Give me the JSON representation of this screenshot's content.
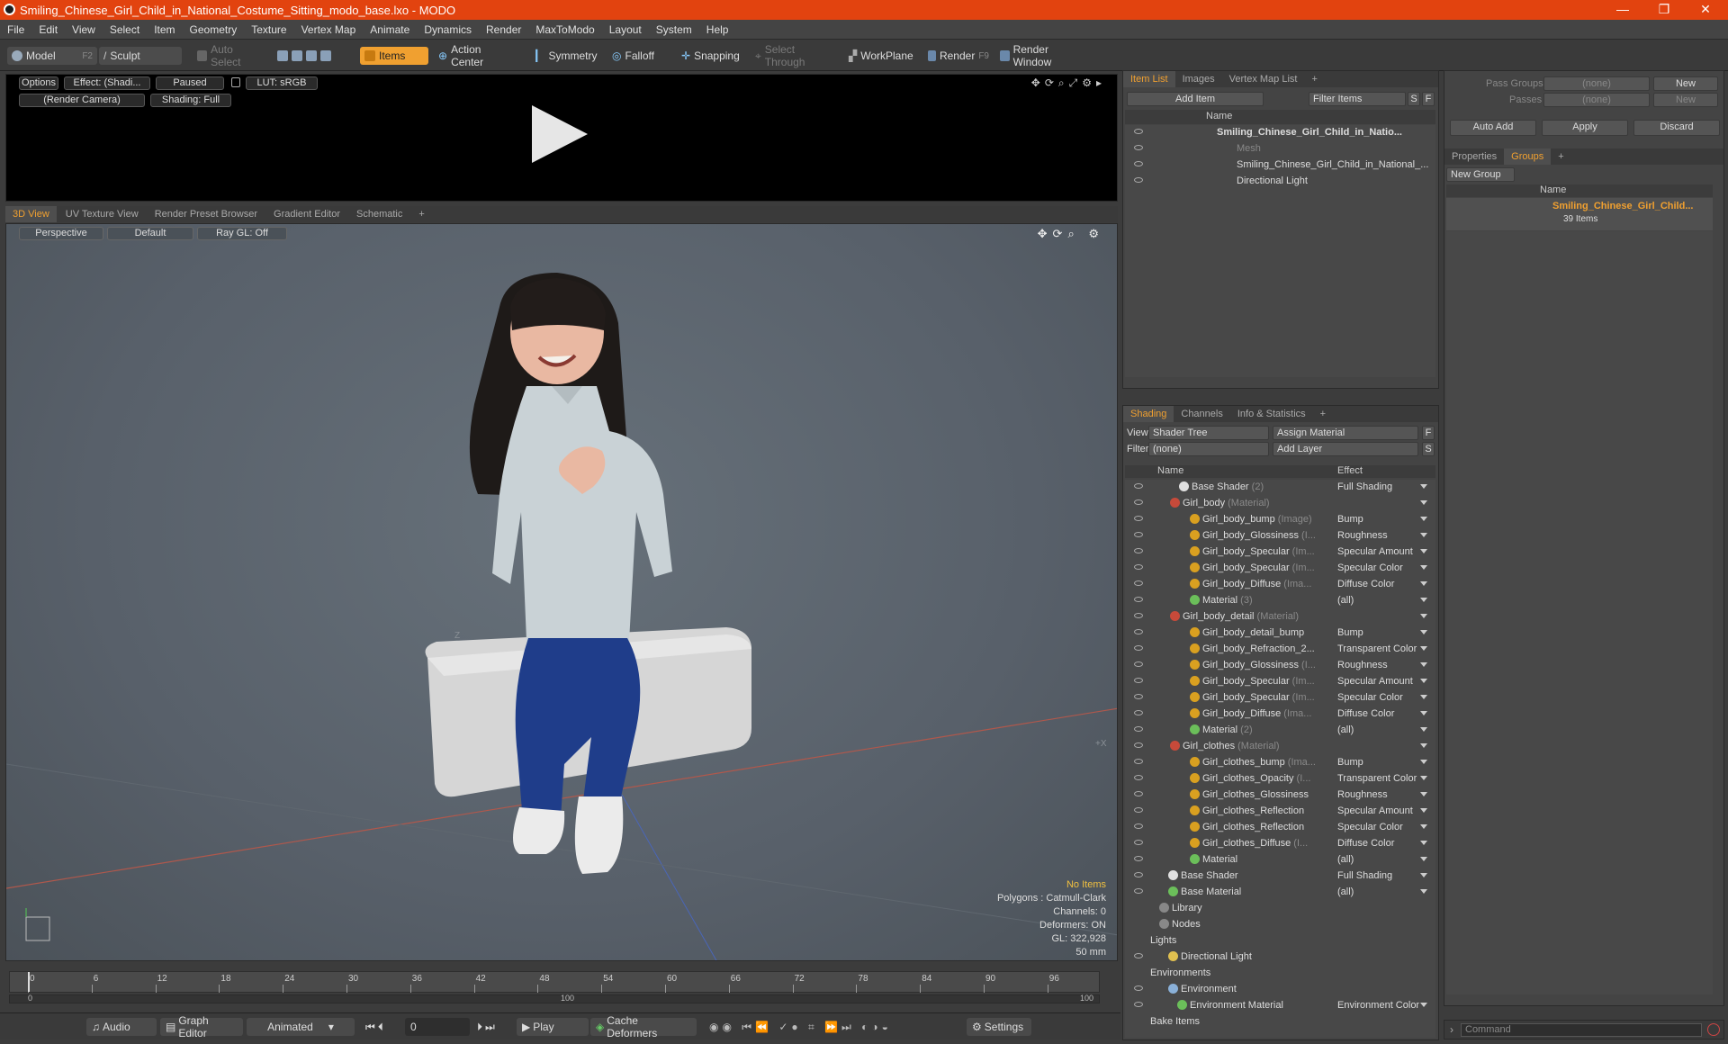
{
  "window": {
    "title": "Smiling_Chinese_Girl_Child_in_National_Costume_Sitting_modo_base.lxo - MODO",
    "min": "—",
    "max": "❐",
    "close": "✕"
  },
  "menu": [
    "File",
    "Edit",
    "View",
    "Select",
    "Item",
    "Geometry",
    "Texture",
    "Vertex Map",
    "Animate",
    "Dynamics",
    "Render",
    "MaxToModo",
    "Layout",
    "System",
    "Help"
  ],
  "toolbar": {
    "model": "Model",
    "model_key": "F2",
    "sculpt": "Sculpt",
    "auto_select": "Auto Select",
    "items": "Items",
    "action_center": "Action Center",
    "symmetry": "Symmetry",
    "falloff": "Falloff",
    "snapping": "Snapping",
    "select_through": "Select Through",
    "workplane": "WorkPlane",
    "render": "Render",
    "render_key": "F9",
    "render_window": "Render Window"
  },
  "preview": {
    "options": "Options",
    "effect": "Effect: (Shadi...",
    "paused": "Paused",
    "lut": "LUT: sRGB",
    "camera": "(Render Camera)",
    "shading": "Shading: Full"
  },
  "view_tabs": [
    "3D View",
    "UV Texture View",
    "Render Preset Browser",
    "Gradient Editor",
    "Schematic",
    "+"
  ],
  "viewport": {
    "perspective": "Perspective",
    "default": "Default",
    "raygl": "Ray GL: Off",
    "axis_z": "Z",
    "axis_x": "+X"
  },
  "stats": {
    "no_items": "No Items",
    "polygons": "Polygons : Catmull-Clark",
    "channels": "Channels: 0",
    "deformers": "Deformers: ON",
    "gl": "GL: 322,928",
    "focal": "50 mm"
  },
  "timeline": {
    "ticks": [
      "0",
      "6",
      "12",
      "18",
      "24",
      "30",
      "36",
      "42",
      "48",
      "54",
      "60",
      "66",
      "72",
      "78",
      "84",
      "90",
      "96"
    ],
    "start": "0",
    "mid": "100",
    "end": "100"
  },
  "bottom": {
    "audio": "Audio",
    "graph_editor": "Graph Editor",
    "animated": "Animated",
    "frame": "0",
    "play": "Play",
    "cache": "Cache Deformers",
    "settings": "Settings"
  },
  "itemlist": {
    "tabs": [
      "Item List",
      "Images",
      "Vertex Map List",
      "+"
    ],
    "add_item": "Add Item",
    "filter_items": "Filter Items",
    "s": "S",
    "f": "F",
    "col_name": "Name",
    "rows": [
      "Smiling_Chinese_Girl_Child_in_Natio...",
      "Mesh",
      "Smiling_Chinese_Girl_Child_in_National_...",
      "Directional Light"
    ]
  },
  "shading": {
    "tabs": [
      "Shading",
      "Channels",
      "Info & Statistics",
      "+"
    ],
    "view_label": "View",
    "view_value": "Shader Tree",
    "assign": "Assign Material",
    "filter_label": "Filter",
    "filter_value": "(none)",
    "add_layer": "Add Layer",
    "f": "F",
    "s": "S",
    "col_name": "Name",
    "col_effect": "Effect",
    "rows": [
      {
        "name": "Base Shader",
        "sub": "(2)",
        "effect": "Full Shading",
        "indent": 48,
        "kind": "shader"
      },
      {
        "name": "Girl_body",
        "sub": "(Material)",
        "effect": "",
        "indent": 38,
        "kind": "mat"
      },
      {
        "name": "Girl_body_bump",
        "sub": "(Image)",
        "effect": "Bump",
        "indent": 60,
        "kind": "img"
      },
      {
        "name": "Girl_body_Glossiness",
        "sub": "(I...",
        "effect": "Roughness",
        "indent": 60,
        "kind": "img"
      },
      {
        "name": "Girl_body_Specular",
        "sub": "(Im...",
        "effect": "Specular Amount",
        "indent": 60,
        "kind": "img"
      },
      {
        "name": "Girl_body_Specular",
        "sub": "(Im...",
        "effect": "Specular Color",
        "indent": 60,
        "kind": "img"
      },
      {
        "name": "Girl_body_Diffuse",
        "sub": "(Ima...",
        "effect": "Diffuse Color",
        "indent": 60,
        "kind": "img"
      },
      {
        "name": "Material",
        "sub": "(3)",
        "effect": "(all)",
        "indent": 60,
        "kind": "matg"
      },
      {
        "name": "Girl_body_detail",
        "sub": "(Material)",
        "effect": "",
        "indent": 38,
        "kind": "mat"
      },
      {
        "name": "Girl_body_detail_bump",
        "sub": "",
        "effect": "Bump",
        "indent": 60,
        "kind": "img"
      },
      {
        "name": "Girl_body_Refraction_2...",
        "sub": "",
        "effect": "Transparent Color",
        "indent": 60,
        "kind": "img"
      },
      {
        "name": "Girl_body_Glossiness",
        "sub": "(I...",
        "effect": "Roughness",
        "indent": 60,
        "kind": "img"
      },
      {
        "name": "Girl_body_Specular",
        "sub": "(Im...",
        "effect": "Specular Amount",
        "indent": 60,
        "kind": "img"
      },
      {
        "name": "Girl_body_Specular",
        "sub": "(Im...",
        "effect": "Specular Color",
        "indent": 60,
        "kind": "img"
      },
      {
        "name": "Girl_body_Diffuse",
        "sub": "(Ima...",
        "effect": "Diffuse Color",
        "indent": 60,
        "kind": "img"
      },
      {
        "name": "Material",
        "sub": "(2)",
        "effect": "(all)",
        "indent": 60,
        "kind": "matg"
      },
      {
        "name": "Girl_clothes",
        "sub": "(Material)",
        "effect": "",
        "indent": 38,
        "kind": "mat"
      },
      {
        "name": "Girl_clothes_bump",
        "sub": "(Ima...",
        "effect": "Bump",
        "indent": 60,
        "kind": "img"
      },
      {
        "name": "Girl_clothes_Opacity",
        "sub": "(I...",
        "effect": "Transparent Color",
        "indent": 60,
        "kind": "img"
      },
      {
        "name": "Girl_clothes_Glossiness",
        "sub": "",
        "effect": "Roughness",
        "indent": 60,
        "kind": "img"
      },
      {
        "name": "Girl_clothes_Reflection",
        "sub": "",
        "effect": "Specular Amount",
        "indent": 60,
        "kind": "img"
      },
      {
        "name": "Girl_clothes_Reflection",
        "sub": "",
        "effect": "Specular Color",
        "indent": 60,
        "kind": "img"
      },
      {
        "name": "Girl_clothes_Diffuse",
        "sub": "(I...",
        "effect": "Diffuse Color",
        "indent": 60,
        "kind": "img"
      },
      {
        "name": "Material",
        "sub": "",
        "effect": "(all)",
        "indent": 60,
        "kind": "matg"
      },
      {
        "name": "Base Shader",
        "sub": "",
        "effect": "Full Shading",
        "indent": 36,
        "kind": "shader"
      },
      {
        "name": "Base Material",
        "sub": "",
        "effect": "(all)",
        "indent": 36,
        "kind": "matg"
      },
      {
        "name": "Library",
        "sub": "",
        "effect": "",
        "indent": 26,
        "kind": "folder"
      },
      {
        "name": "Nodes",
        "sub": "",
        "effect": "",
        "indent": 26,
        "kind": "folder"
      },
      {
        "name": "Lights",
        "sub": "",
        "effect": "",
        "indent": 16,
        "kind": "none"
      },
      {
        "name": "Directional Light",
        "sub": "",
        "effect": "",
        "indent": 36,
        "kind": "light"
      },
      {
        "name": "Environments",
        "sub": "",
        "effect": "",
        "indent": 16,
        "kind": "none"
      },
      {
        "name": "Environment",
        "sub": "",
        "effect": "",
        "indent": 36,
        "kind": "env"
      },
      {
        "name": "Environment Material",
        "sub": "",
        "effect": "Environment Color",
        "indent": 46,
        "kind": "matg"
      },
      {
        "name": "Bake Items",
        "sub": "",
        "effect": "",
        "indent": 16,
        "kind": "none"
      }
    ]
  },
  "right": {
    "pass_groups": "Pass Groups",
    "passes": "Passes",
    "none": "(none)",
    "new": "New",
    "auto_add": "Auto Add",
    "apply": "Apply",
    "discard": "Discard",
    "tabs": [
      "Properties",
      "Groups",
      "+"
    ],
    "new_group": "New Group",
    "col_name": "Name",
    "group_name": "Smiling_Chinese_Girl_Child...",
    "group_count": "39 Items",
    "command": "Command"
  },
  "colors": {
    "accent": "#f0a030",
    "titlebar": "#e2430f"
  }
}
